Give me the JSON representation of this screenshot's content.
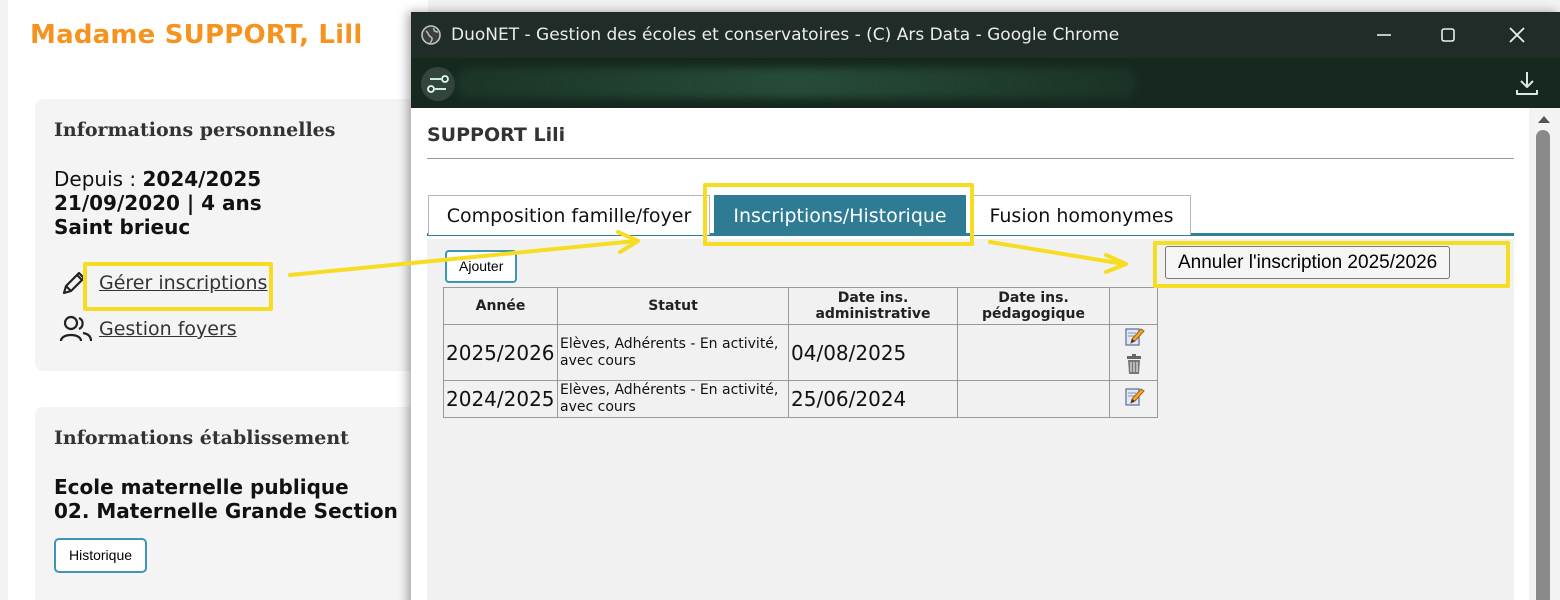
{
  "background_page": {
    "person_name": "Madame  SUPPORT, Lill",
    "personal_info": {
      "title": "Informations personnelles",
      "since_label": "Depuis : ",
      "since_value": "2024/2025",
      "birth_line": "21/09/2020 | 4 ans",
      "city": "Saint brieuc",
      "links": [
        {
          "label": "Gérer inscriptions",
          "icon": "pencil-icon"
        },
        {
          "label": "Gestion foyers",
          "icon": "users-icon"
        }
      ]
    },
    "school_info": {
      "title": "Informations établissement",
      "school": "Ecole maternelle publique",
      "class": "02. Maternelle Grande Section",
      "history_button": "Historique"
    }
  },
  "popup": {
    "window_title": "DuoNET - Gestion des écoles et conservatoires - (C) Ars Data - Google Chrome",
    "heading": "SUPPORT Lili",
    "tabs": [
      {
        "label": "Composition famille/foyer",
        "active": false
      },
      {
        "label": "Inscriptions/Historique",
        "active": true
      },
      {
        "label": "Fusion homonymes",
        "active": false
      }
    ],
    "add_button": "Ajouter",
    "cancel_button": "Annuler l'inscription 2025/2026",
    "table": {
      "headers": [
        "Année",
        "Statut",
        "Date ins. administrative",
        "Date ins. pédagogique",
        ""
      ],
      "rows": [
        {
          "year": "2025/2026",
          "status": "Elèves, Adhérents - En activité, avec cours",
          "date_admin": "04/08/2025",
          "date_peda": "",
          "actions": [
            "edit-icon",
            "trash-icon"
          ]
        },
        {
          "year": "2024/2025",
          "status": "Elèves, Adhérents - En activité, avec cours",
          "date_admin": "25/06/2024",
          "date_peda": "",
          "actions": [
            "edit-icon"
          ]
        }
      ]
    }
  },
  "colors": {
    "orange_title": "#f5931e",
    "tab_active": "#2e7b93",
    "highlight": "#f6dc22",
    "titlebar": "#1f2c28"
  }
}
